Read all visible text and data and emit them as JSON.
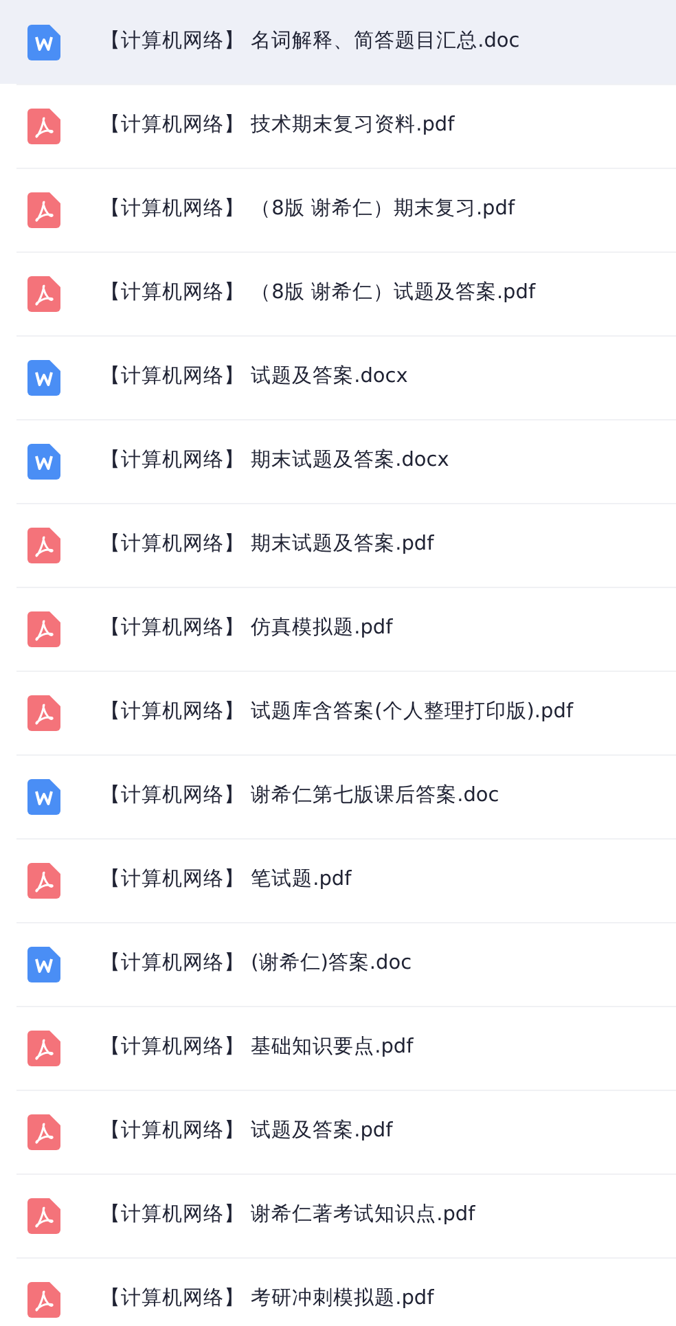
{
  "files": [
    {
      "kind": "word",
      "name": "【计算机网络】 名词解释、简答题目汇总.doc",
      "selected": true
    },
    {
      "kind": "pdf",
      "name": "【计算机网络】 技术期末复习资料.pdf",
      "selected": false
    },
    {
      "kind": "pdf",
      "name": "【计算机网络】 （8版 谢希仁）期末复习.pdf",
      "selected": false
    },
    {
      "kind": "pdf",
      "name": "【计算机网络】 （8版 谢希仁）试题及答案.pdf",
      "selected": false
    },
    {
      "kind": "word",
      "name": "【计算机网络】 试题及答案.docx",
      "selected": false
    },
    {
      "kind": "word",
      "name": "【计算机网络】 期末试题及答案.docx",
      "selected": false
    },
    {
      "kind": "pdf",
      "name": "【计算机网络】 期末试题及答案.pdf",
      "selected": false
    },
    {
      "kind": "pdf",
      "name": "【计算机网络】 仿真模拟题.pdf",
      "selected": false
    },
    {
      "kind": "pdf",
      "name": "【计算机网络】 试题库含答案(个人整理打印版).pdf",
      "selected": false
    },
    {
      "kind": "word",
      "name": "【计算机网络】 谢希仁第七版课后答案.doc",
      "selected": false
    },
    {
      "kind": "pdf",
      "name": "【计算机网络】 笔试题.pdf",
      "selected": false
    },
    {
      "kind": "word",
      "name": "【计算机网络】 (谢希仁)答案.doc",
      "selected": false
    },
    {
      "kind": "pdf",
      "name": "【计算机网络】 基础知识要点.pdf",
      "selected": false
    },
    {
      "kind": "pdf",
      "name": "【计算机网络】 试题及答案.pdf",
      "selected": false
    },
    {
      "kind": "pdf",
      "name": "【计算机网络】 谢希仁著考试知识点.pdf",
      "selected": false
    },
    {
      "kind": "pdf",
      "name": "【计算机网络】 考研冲刺模拟题.pdf",
      "selected": false
    }
  ]
}
